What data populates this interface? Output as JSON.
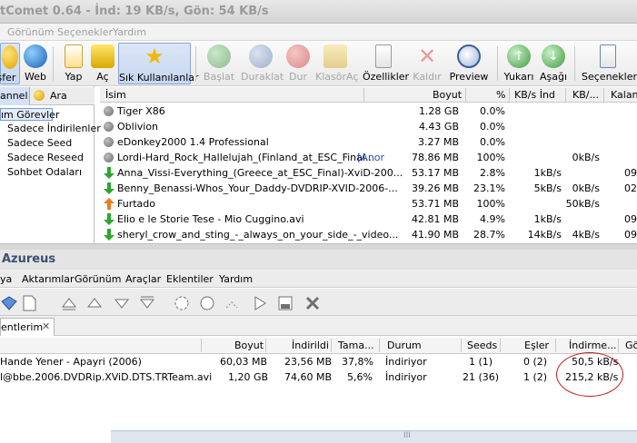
{
  "window_title": "tComet 0.64 - İnd: 19 KB/s, Gön: 54 KB/s",
  "menu1": [
    "Görünüm",
    "Seçenekler",
    "Yardım"
  ],
  "toolbar1": {
    "sfer": "sfer",
    "web": "Web",
    "yap": "Yap",
    "ac": "Aç",
    "sik": "Sık Kullanılanlar",
    "baslat": "Başlat",
    "duraklat": "Duraklat",
    "dur": "Dur",
    "klasorac": "KlasörAç",
    "ozellikler": "Özellikler",
    "kaldir": "Kaldır",
    "preview": "Preview",
    "yukari": "Yukarı",
    "asagi": "Aşağı",
    "secenekler": "Seçenekler"
  },
  "left_tabs": {
    "channel": "annel",
    "ara": "Ara"
  },
  "tree": {
    "root": "ım Görevler",
    "items": [
      "Sadece İndirilenler",
      "Sadece Seed",
      "Sadece Reseed",
      "Sohbet Odaları"
    ]
  },
  "top_list": {
    "columns": [
      "İsim",
      "Boyut",
      "%",
      "KB/s İnd",
      "KB/...",
      "Kalan"
    ],
    "rows": [
      {
        "icon": "gray-ball-icon",
        "name": "Tiger X86",
        "extra": "",
        "size": "1.28 GB",
        "pct": "0.0%",
        "down": "",
        "up": "",
        "left": ""
      },
      {
        "icon": "gray-ball-icon",
        "name": "Oblivion",
        "extra": "",
        "size": "4.43 GB",
        "pct": "0.0%",
        "down": "",
        "up": "",
        "left": ""
      },
      {
        "icon": "gray-ball-icon",
        "name": "eDonkey2000 1.4 Professional",
        "extra": "",
        "size": "3.27 MB",
        "pct": "0.0%",
        "down": "",
        "up": "",
        "left": ""
      },
      {
        "icon": "gray-ball-icon",
        "name": "Lordi-Hard_Rock_Hallelujah_(Finland_at_ESC_Final...",
        "extra": "[Anor",
        "size": "78.86 MB",
        "pct": "100%",
        "down": "",
        "up": "0kB/s",
        "left": ""
      },
      {
        "icon": "green-down-arrow-icon",
        "name": "Anna_Vissi-Everything_(Greece_at_ESC_Final)-XviD-200...",
        "extra": "",
        "size": "53.17 MB",
        "pct": "2.8%",
        "down": "1kB/s",
        "up": "",
        "left": "09:"
      },
      {
        "icon": "green-down-arrow-icon",
        "name": "Benny_Benassi-Whos_Your_Daddy-DVDRIP-XVID-2006-...",
        "extra": "",
        "size": "39.26 MB",
        "pct": "23.1%",
        "down": "5kB/s",
        "up": "0kB/s",
        "left": "02:"
      },
      {
        "icon": "orange-up-arrow-icon",
        "name": "Furtado",
        "extra": "",
        "size": "53.71 MB",
        "pct": "100%",
        "down": "",
        "up": "50kB/s",
        "left": ""
      },
      {
        "icon": "green-down-arrow-icon",
        "name": "Elio e le Storie Tese - Mio Cuggino.avi",
        "extra": "",
        "size": "42.81 MB",
        "pct": "4.9%",
        "down": "1kB/s",
        "up": "",
        "left": "09:"
      },
      {
        "icon": "green-down-arrow-icon",
        "name": "sheryl_crow_and_sting_-_always_on_your_side_-_video...",
        "extra": "",
        "size": "41.90 MB",
        "pct": "28.7%",
        "down": "14kB/s",
        "up": "4kB/s",
        "left": "09:"
      }
    ]
  },
  "azureus": {
    "title": "Azureus",
    "menu": [
      "ya",
      "Aktarımlar",
      "Görünüm",
      "Araçlar",
      "Eklentiler",
      "Yardım"
    ],
    "tab": "entlerim",
    "columns": [
      "Boyut",
      "İndirildi",
      "Tama...",
      "Durum",
      "Seeds",
      "Eşler",
      "İndirme...",
      "Gö"
    ],
    "rows": [
      {
        "name": "Hande Yener - Apayri (2006)",
        "size": "60,03 MB",
        "downloaded": "23,56 MB",
        "done": "37,8%",
        "status": "İndiriyor",
        "seeds": "1 (1)",
        "peers": "0 (2)",
        "speed": "50,5 kB/s"
      },
      {
        "name": "l@bbe.2006.DVDRip.XViD.DTS.TRTeam.avi",
        "size": "1,20 GB",
        "downloaded": "74,60 MB",
        "done": "5,6%",
        "status": "İndiriyor",
        "seeds": "21 (36)",
        "peers": "1 (2)",
        "speed": "215,2 kB/s"
      }
    ],
    "scroll_label": "III"
  },
  "colors": {
    "annotation_circle": "#c51a1a",
    "accent": "#3c4f72"
  }
}
